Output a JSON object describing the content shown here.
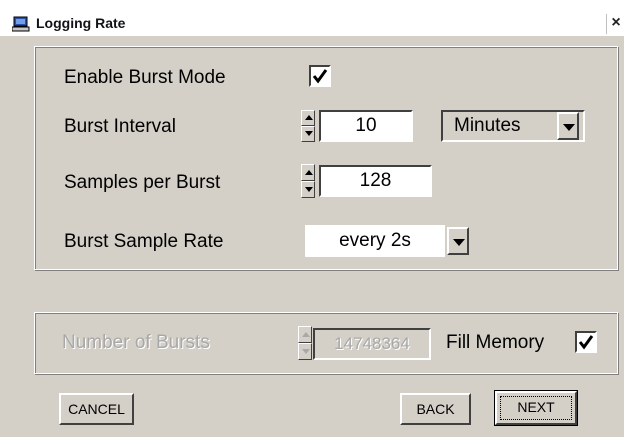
{
  "window": {
    "title": "Logging Rate",
    "close_glyph": "×",
    "icon": "computer-icon"
  },
  "burst_group": {
    "enable_burst_mode": {
      "label": "Enable Burst Mode",
      "checked": true
    },
    "burst_interval": {
      "label": "Burst Interval",
      "value": "10",
      "unit": "Minutes"
    },
    "samples_per_burst": {
      "label": "Samples per Burst",
      "value": "128"
    },
    "burst_sample_rate": {
      "label": "Burst Sample Rate",
      "value": "every 2s"
    }
  },
  "bursts_group": {
    "number_of_bursts": {
      "label": "Number of Bursts",
      "value": "14748364",
      "enabled": false
    },
    "fill_memory": {
      "label": "Fill Memory",
      "checked": true
    }
  },
  "buttons": {
    "cancel": "CANCEL",
    "back": "BACK",
    "next": "NEXT"
  },
  "colors": {
    "face": "#d4d0c8",
    "disabled_text": "#a8a8a8"
  }
}
